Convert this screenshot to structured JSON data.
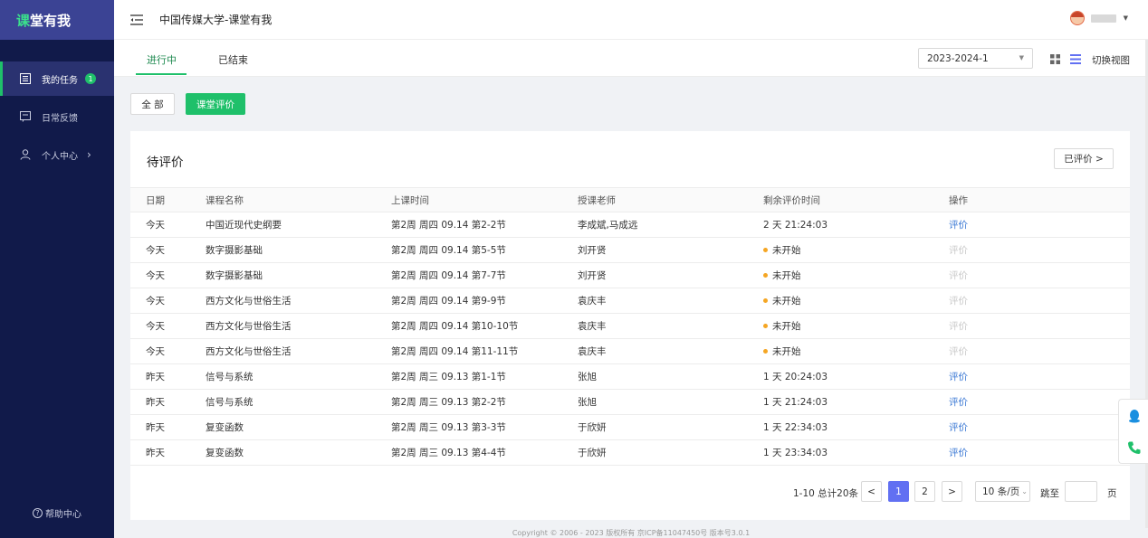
{
  "app": {
    "logo_accent": "课",
    "logo_rest": "堂有我",
    "header_title": "中国传媒大学-课堂有我"
  },
  "sidebar": {
    "items": [
      {
        "label": "我的任务",
        "badge": "1"
      },
      {
        "label": "日常反馈"
      },
      {
        "label": "个人中心"
      }
    ],
    "help_label": "帮助中心"
  },
  "tabs": {
    "ongoing": "进行中",
    "ended": "已结束"
  },
  "term": {
    "selected": "2023-2024-1"
  },
  "view": {
    "toggle_label": "切换视图"
  },
  "filters": {
    "all": "全 部",
    "evaluation": "课堂评价"
  },
  "card": {
    "title": "待评价",
    "evaluated_button": "已评价 >"
  },
  "table": {
    "headers": [
      "日期",
      "课程名称",
      "上课时间",
      "授课老师",
      "剩余评价时间",
      "操作"
    ],
    "rows": [
      {
        "date": "今天",
        "course": "中国近现代史纲要",
        "time": "第2周 周四 09.14 第2-2节",
        "teacher": "李成斌,马成远",
        "remain": "2 天 21:24:03",
        "pending": false,
        "action": "评价",
        "enabled": true
      },
      {
        "date": "今天",
        "course": "数字摄影基础",
        "time": "第2周 周四 09.14 第5-5节",
        "teacher": "刘开贤",
        "remain": "未开始",
        "pending": true,
        "action": "评价",
        "enabled": false
      },
      {
        "date": "今天",
        "course": "数字摄影基础",
        "time": "第2周 周四 09.14 第7-7节",
        "teacher": "刘开贤",
        "remain": "未开始",
        "pending": true,
        "action": "评价",
        "enabled": false
      },
      {
        "date": "今天",
        "course": "西方文化与世俗生活",
        "time": "第2周 周四 09.14 第9-9节",
        "teacher": "袁庆丰",
        "remain": "未开始",
        "pending": true,
        "action": "评价",
        "enabled": false
      },
      {
        "date": "今天",
        "course": "西方文化与世俗生活",
        "time": "第2周 周四 09.14 第10-10节",
        "teacher": "袁庆丰",
        "remain": "未开始",
        "pending": true,
        "action": "评价",
        "enabled": false
      },
      {
        "date": "今天",
        "course": "西方文化与世俗生活",
        "time": "第2周 周四 09.14 第11-11节",
        "teacher": "袁庆丰",
        "remain": "未开始",
        "pending": true,
        "action": "评价",
        "enabled": false
      },
      {
        "date": "昨天",
        "course": "信号与系统",
        "time": "第2周 周三 09.13 第1-1节",
        "teacher": "张旭",
        "remain": "1 天 20:24:03",
        "pending": false,
        "action": "评价",
        "enabled": true
      },
      {
        "date": "昨天",
        "course": "信号与系统",
        "time": "第2周 周三 09.13 第2-2节",
        "teacher": "张旭",
        "remain": "1 天 21:24:03",
        "pending": false,
        "action": "评价",
        "enabled": true
      },
      {
        "date": "昨天",
        "course": "复变函数",
        "time": "第2周 周三 09.13 第3-3节",
        "teacher": "于欣妍",
        "remain": "1 天 22:34:03",
        "pending": false,
        "action": "评价",
        "enabled": true
      },
      {
        "date": "昨天",
        "course": "复变函数",
        "time": "第2周 周三 09.13 第4-4节",
        "teacher": "于欣妍",
        "remain": "1 天 23:34:03",
        "pending": false,
        "action": "评价",
        "enabled": true
      }
    ]
  },
  "pagination": {
    "total_text": "1-10 总计20条",
    "pages": [
      "1",
      "2"
    ],
    "current": "1",
    "prev": "<",
    "next": ">",
    "page_size": "10 条/页",
    "jump_label": "跳至",
    "jump_unit": "页"
  },
  "footer": {
    "text": "Copyright © 2006 - 2023 版权所有 京ICP备11047450号 版本号3.0.1"
  },
  "colors": {
    "sidebar_bg": "#111a4a",
    "logo_bg": "#3b4394",
    "accent_green": "#1fc06a",
    "link_blue": "#3a78d4",
    "pager_active": "#6170f2",
    "pending_dot": "#f5a623"
  }
}
